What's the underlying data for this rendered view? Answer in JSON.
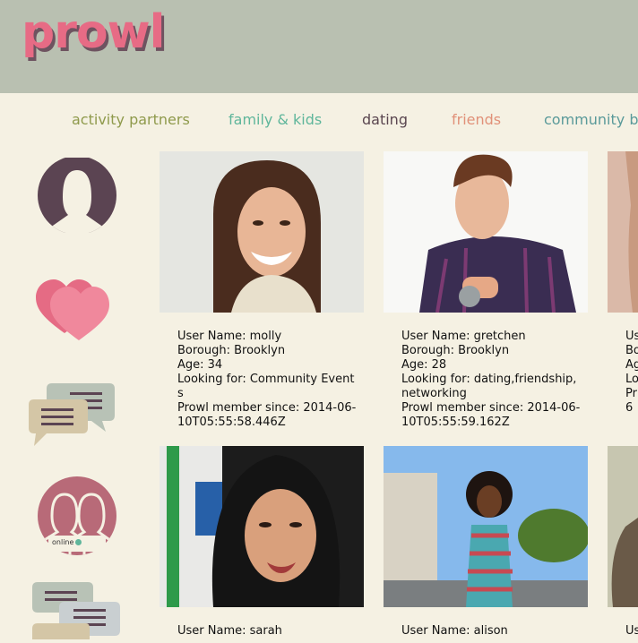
{
  "header": {
    "logo": "prowl"
  },
  "nav": {
    "items": [
      {
        "label": "activity partners",
        "color": "#8f9a4c"
      },
      {
        "label": "family & kids",
        "color": "#5fb69b"
      },
      {
        "label": "dating",
        "color": "#5a4650"
      },
      {
        "label": "friends",
        "color": "#e19179"
      },
      {
        "label": "community b",
        "color": "#5a9a9a"
      }
    ]
  },
  "sidebar": {
    "icons": [
      "profile-icon",
      "heart-icon",
      "chat-icon",
      "online-users-icon",
      "messages-icon"
    ],
    "online_label": "online"
  },
  "profiles": [
    {
      "username": "User Name: molly",
      "borough": "Borough: Brooklyn",
      "age": "Age: 34",
      "looking": "Looking for: Community Events",
      "since": "Prowl member since: 2014-06-10T05:55:58.446Z"
    },
    {
      "username": "User Name: gretchen",
      "borough": "Borough: Brooklyn",
      "age": "Age: 28",
      "looking": "Looking for: dating,friendship,networking",
      "since": "Prowl member since: 2014-06-10T05:55:59.162Z"
    },
    {
      "username": "Us",
      "borough": "Bo",
      "age": "Ag",
      "looking": "Lo",
      "since": "Pr 06"
    },
    {
      "username": "User Name: sarah"
    },
    {
      "username": "User Name: alison"
    },
    {
      "username": "Us"
    }
  ],
  "colors": {
    "background": "#f5f1e3",
    "header": "#b9c0b1",
    "logo": "#e76b85",
    "icon_dark": "#5b4452",
    "icon_pink": "#e8708a"
  }
}
